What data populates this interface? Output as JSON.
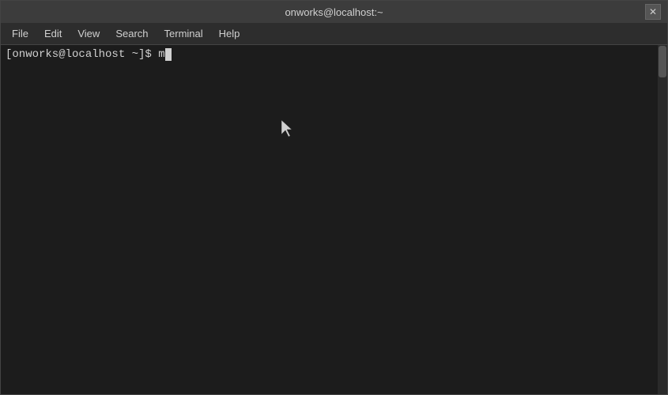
{
  "titlebar": {
    "title": "onworks@localhost:~",
    "close_label": "✕"
  },
  "menubar": {
    "items": [
      {
        "id": "file",
        "label": "File"
      },
      {
        "id": "edit",
        "label": "Edit"
      },
      {
        "id": "view",
        "label": "View"
      },
      {
        "id": "search",
        "label": "Search"
      },
      {
        "id": "terminal",
        "label": "Terminal"
      },
      {
        "id": "help",
        "label": "Help"
      }
    ]
  },
  "terminal": {
    "prompt": "[onworks@localhost ~]$ ",
    "input": "m"
  },
  "colors": {
    "background": "#1c1c1c",
    "text": "#d0d0d0",
    "titlebar_bg": "#3c3c3c",
    "menubar_bg": "#2d2d2d"
  }
}
